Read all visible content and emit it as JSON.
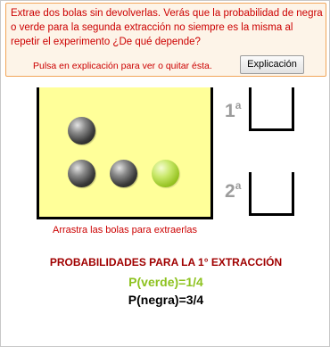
{
  "instructions": {
    "text": "Extrae dos bolas sin devolverlas. Verás que la probabilidad de negra o verde para la segunda extracción no siempre es la misma al repetir el experimento  ¿De qué  depende?",
    "hint": "Pulsa en explicación para ver o quitar ésta.",
    "button_label": "Explicación"
  },
  "urn": {
    "caption": "Arrastra las bolas para extraerlas",
    "balls": [
      "black",
      "black",
      "black",
      "green"
    ]
  },
  "slots": {
    "first": {
      "number": "1",
      "suffix": "a"
    },
    "second": {
      "number": "2",
      "suffix": "a"
    }
  },
  "probabilities": {
    "title": "PROBABILIDADES PARA LA 1° EXTRACCIÓN",
    "green": "P(verde)=1/4",
    "black": "P(negra)=3/4"
  },
  "colors": {
    "instruction_text": "#cc0000",
    "instruction_border": "#f2a65a",
    "urn_fill": "#ffff99",
    "slot_label": "#9c9c9c",
    "prob_title": "#a00000",
    "prob_green": "#8dc21f",
    "prob_black": "#000000"
  }
}
